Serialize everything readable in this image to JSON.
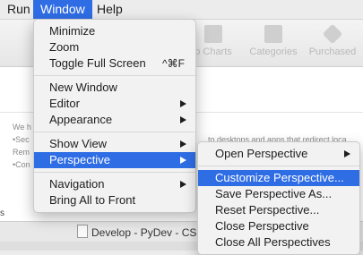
{
  "menubar": {
    "items": [
      "Run",
      "Window",
      "Help"
    ]
  },
  "toolbar": {
    "buttons": [
      "p Charts",
      "Categories",
      "Purchased"
    ]
  },
  "background": {
    "lines": [
      "We h",
      "•Sec",
      "Rem",
      "•Con"
    ],
    "fragment": "to desktops and apps that redirect loca",
    "side_label": "s"
  },
  "status": {
    "item": "Develop - PyDev - CS"
  },
  "window_menu": {
    "items": [
      {
        "label": "Minimize"
      },
      {
        "label": "Zoom"
      },
      {
        "label": "Toggle Full Screen",
        "shortcut": "^⌘F"
      },
      {
        "label": "New Window"
      },
      {
        "label": "Editor",
        "submenu": true
      },
      {
        "label": "Appearance",
        "submenu": true
      },
      {
        "label": "Show View",
        "submenu": true
      },
      {
        "label": "Perspective",
        "submenu": true,
        "highlighted": true
      },
      {
        "label": "Navigation",
        "submenu": true
      },
      {
        "label": "Bring All to Front"
      }
    ]
  },
  "perspective_menu": {
    "items": [
      {
        "label": "Open Perspective",
        "submenu": true
      },
      {
        "label": "Customize Perspective...",
        "highlighted": true
      },
      {
        "label": "Save Perspective As..."
      },
      {
        "label": "Reset Perspective..."
      },
      {
        "label": "Close Perspective"
      },
      {
        "label": "Close All Perspectives"
      }
    ]
  },
  "colors": {
    "highlight": "#2f6de5",
    "menu_bg": "#f2f2f2",
    "menubar_bg": "#ececec"
  }
}
